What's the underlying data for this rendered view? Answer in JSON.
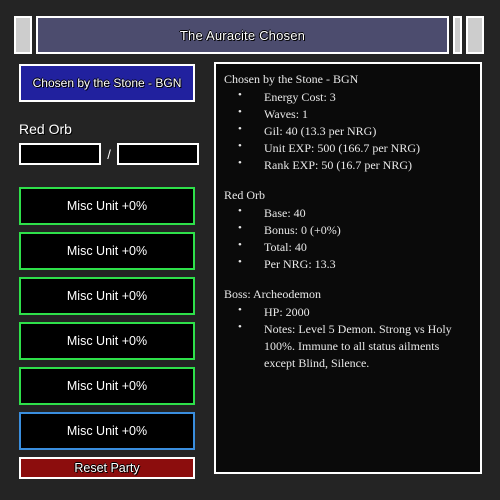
{
  "window": {
    "title": "The Auracite Chosen"
  },
  "left_panel": {
    "stage_button_label": "Chosen by the Stone - BGN",
    "orb_label": "Red Orb",
    "orb_separator": "/",
    "orb_input_left_value": "",
    "orb_input_left_placeholder": "",
    "orb_input_right_value": "",
    "orb_input_right_placeholder": "",
    "units": [
      {
        "label": "Misc Unit  +0%",
        "border_color": "#2ee04a"
      },
      {
        "label": "Misc Unit  +0%",
        "border_color": "#2ee04a"
      },
      {
        "label": "Misc Unit  +0%",
        "border_color": "#2ee04a"
      },
      {
        "label": "Misc Unit  +0%",
        "border_color": "#2ee04a"
      },
      {
        "label": "Misc Unit  +0%",
        "border_color": "#2ee04a"
      },
      {
        "label": "Misc Unit  +0%",
        "border_color": "#3a8ede"
      }
    ],
    "reset_button_label": "Reset Party"
  },
  "info_panel": {
    "stage": {
      "heading": "Chosen by the Stone - BGN",
      "items": [
        "Energy Cost:  3",
        "Waves:  1",
        "Gil:  40 (13.3 per NRG)",
        "Unit EXP:  500 (166.7 per NRG)",
        "Rank EXP:  50 (16.7 per NRG)"
      ]
    },
    "orb": {
      "heading": "Red Orb",
      "items": [
        "Base:  40",
        "Bonus:  0 (+0%)",
        "Total:  40",
        "Per NRG:  13.3"
      ]
    },
    "boss": {
      "heading": "Boss:  Archeodemon",
      "items": [
        "HP:  2000",
        "Notes:  Level 5 Demon.  Strong vs Holy 100%.  Immune to all status ailments except Blind, Silence."
      ]
    }
  },
  "colors": {
    "background": "#242424",
    "titlebar_fill": "#4c4c6e",
    "stage_button_fill": "#21219e",
    "reset_button_fill": "#8c0d0d",
    "unit_border_green": "#2ee04a",
    "unit_border_blue": "#3a8ede",
    "panel_background": "#0a0a0a",
    "border_white": "#ffffff"
  }
}
